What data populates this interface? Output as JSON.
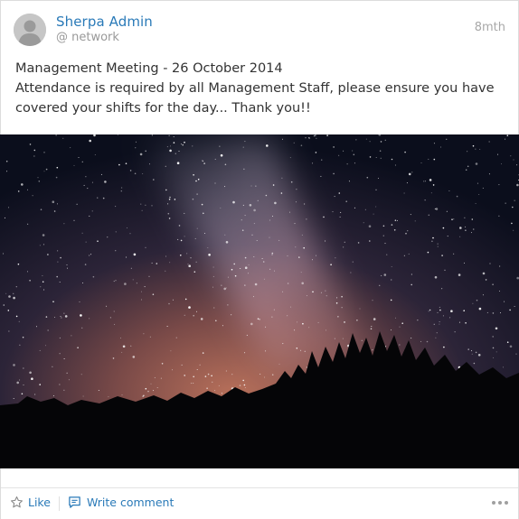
{
  "post": {
    "author_name": "Sherpa Admin",
    "author_network": "@ network",
    "timestamp": "8mth",
    "body_lines": [
      "Management Meeting - 26 October 2014",
      "Attendance is required by all Management Staff, please ensure you have covered your shifts for the day... Thank you!!"
    ]
  },
  "actions": {
    "like_label": "Like",
    "comment_label": "Write comment"
  },
  "colors": {
    "link": "#2a7ab8",
    "muted": "#999999",
    "text": "#333333"
  },
  "icons": {
    "avatar": "default-user-avatar",
    "like": "star-outline-icon",
    "comment": "speech-bubble-icon",
    "more": "more-options-icon"
  }
}
